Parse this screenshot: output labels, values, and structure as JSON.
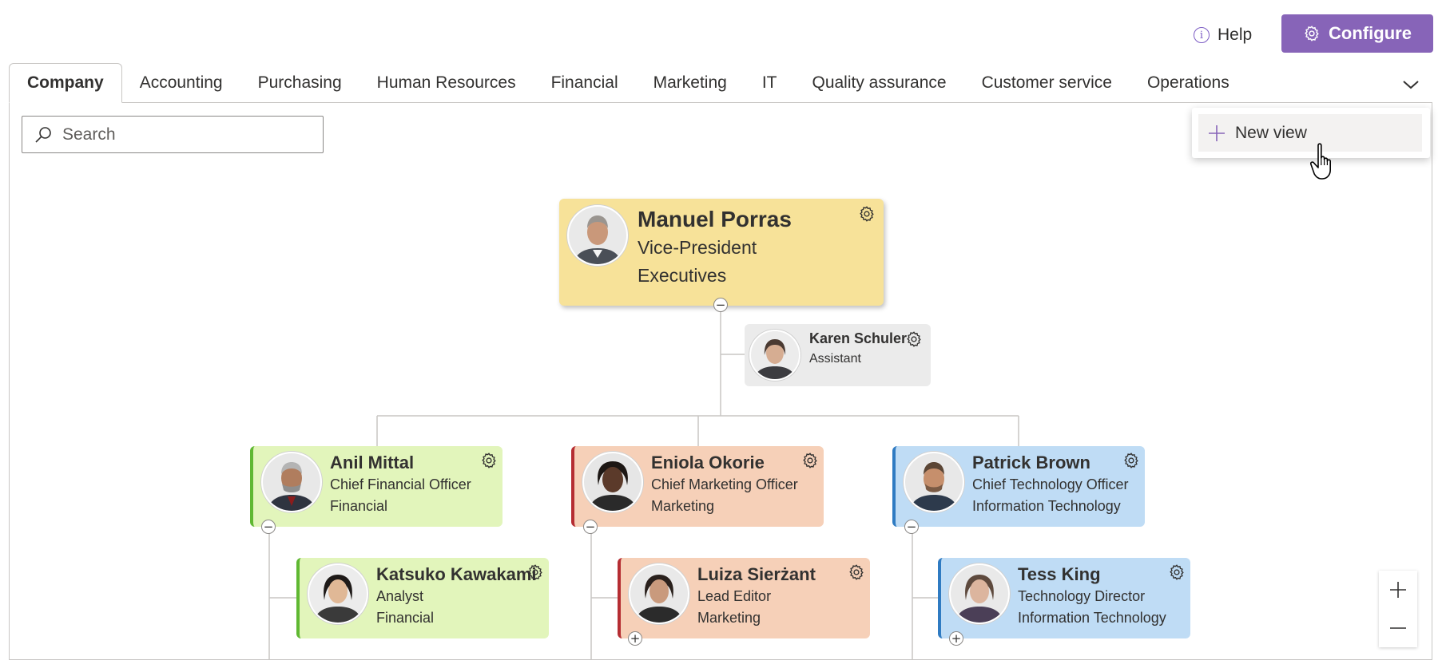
{
  "header": {
    "help_label": "Help",
    "configure_label": "Configure"
  },
  "tabs": [
    {
      "label": "Company"
    },
    {
      "label": "Accounting"
    },
    {
      "label": "Purchasing"
    },
    {
      "label": "Human Resources"
    },
    {
      "label": "Financial"
    },
    {
      "label": "Marketing"
    },
    {
      "label": "IT"
    },
    {
      "label": "Quality assurance"
    },
    {
      "label": "Customer service"
    },
    {
      "label": "Operations"
    }
  ],
  "search": {
    "placeholder": "Search"
  },
  "dropdown": {
    "new_view_label": "New view"
  },
  "colors": {
    "accent": "#8764b8",
    "executive": "#f7e299",
    "financial": "#e2f5bb",
    "marketing": "#f6d0b8",
    "it": "#bfdcf5",
    "assistant": "#ebebeb"
  },
  "people": {
    "root": {
      "name": "Manuel Porras",
      "title": "Vice-President",
      "department": "Executives"
    },
    "assistant": {
      "name": "Karen Schuler",
      "title": "Assistant"
    },
    "anil": {
      "name": "Anil Mittal",
      "title": "Chief Financial Officer",
      "department": "Financial"
    },
    "eniola": {
      "name": "Eniola Okorie",
      "title": "Chief Marketing Officer",
      "department": "Marketing"
    },
    "patrick": {
      "name": "Patrick Brown",
      "title": "Chief Technology Officer",
      "department": "Information Technology"
    },
    "katsuko": {
      "name": "Katsuko Kawakami",
      "title": "Analyst",
      "department": "Financial"
    },
    "luiza": {
      "name": "Luiza Sierżant",
      "title": "Lead Editor",
      "department": "Marketing"
    },
    "tess": {
      "name": "Tess King",
      "title": "Technology Director",
      "department": "Information Technology"
    }
  }
}
